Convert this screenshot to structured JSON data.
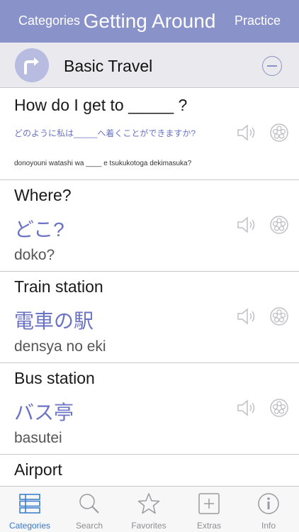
{
  "nav": {
    "left": "Categories",
    "title": "Getting Around",
    "right": "Practice"
  },
  "section": {
    "title": "Basic Travel",
    "icon": "turn-right-arrow-icon"
  },
  "phrases": [
    {
      "english": "How do I get to _____ ?",
      "japanese": "どのように私は_____へ着くことができますか?",
      "romaji": "donoyouni watashi wa ____ e tsukukotoga dekimasuka?"
    },
    {
      "english": "Where?",
      "japanese": "どこ?",
      "romaji": "doko?"
    },
    {
      "english": "Train station",
      "japanese": "電車の駅",
      "romaji": "densya no eki"
    },
    {
      "english": "Bus station",
      "japanese": "バス亭",
      "romaji": "basutei"
    },
    {
      "english": "Airport"
    }
  ],
  "tabs": [
    {
      "label": "Categories",
      "icon": "list-icon",
      "active": true
    },
    {
      "label": "Search",
      "icon": "search-icon"
    },
    {
      "label": "Favorites",
      "icon": "star-icon"
    },
    {
      "label": "Extras",
      "icon": "plus-square-icon"
    },
    {
      "label": "Info",
      "icon": "info-icon"
    }
  ],
  "colors": {
    "navbar": "#8a93c9",
    "accent": "#6b73c4",
    "active_tab": "#3478c9"
  }
}
